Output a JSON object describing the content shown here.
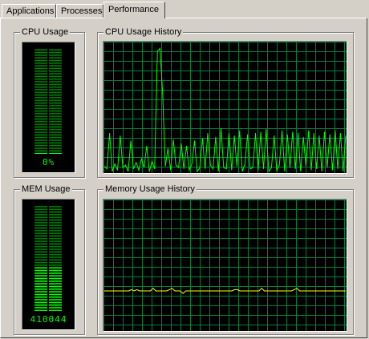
{
  "tabs": [
    {
      "label": "Applications",
      "active": false
    },
    {
      "label": "Processes",
      "active": false
    },
    {
      "label": "Performance",
      "active": true
    }
  ],
  "cpu_usage": {
    "title": "CPU Usage",
    "value_text": "0%",
    "percent": 0
  },
  "cpu_history": {
    "title": "CPU Usage History"
  },
  "mem_usage": {
    "title": "MEM Usage",
    "value_text": "410044",
    "fill_fraction": 0.42
  },
  "mem_history": {
    "title": "Memory Usage History"
  },
  "colors": {
    "grid": "#008040",
    "cpu_line": "#00ff00",
    "mem_line": "#ffff00",
    "meter_off": "#008000",
    "meter_on": "#00ff00"
  },
  "cpu_history_series": [
    4,
    2,
    30,
    0,
    6,
    1,
    28,
    3,
    5,
    0,
    24,
    2,
    7,
    1,
    10,
    3,
    20,
    0,
    8,
    2,
    94,
    96,
    60,
    4,
    18,
    1,
    25,
    5,
    3,
    22,
    2,
    20,
    1,
    6,
    24,
    0,
    3,
    26,
    2,
    30,
    5,
    2,
    27,
    0,
    34,
    3,
    2,
    30,
    1,
    28,
    4,
    32,
    0,
    6,
    29,
    2,
    3,
    30,
    1,
    31,
    2,
    33,
    0,
    3,
    28,
    1,
    5,
    32,
    0,
    29,
    3,
    31,
    2,
    30,
    0,
    27,
    4,
    32,
    1,
    30,
    2,
    28,
    0,
    31,
    3,
    29,
    1,
    32,
    2,
    30,
    0,
    28
  ],
  "mem_history_series": [
    30,
    30,
    30,
    30,
    30,
    30,
    30,
    30,
    30,
    30,
    31,
    30,
    31,
    30,
    30,
    30,
    30,
    30,
    32,
    30,
    30,
    30,
    30,
    30,
    31,
    32,
    30,
    30,
    30,
    28,
    30,
    30,
    30,
    30,
    30,
    30,
    30,
    30,
    30,
    30,
    30,
    30,
    30,
    30,
    30,
    30,
    30,
    30,
    31,
    31,
    30,
    30,
    30,
    30,
    30,
    30,
    30,
    30,
    32,
    30,
    30,
    30,
    30,
    30,
    30,
    30,
    30,
    30,
    30,
    30,
    31,
    32,
    30,
    30,
    30,
    30,
    30,
    30,
    30,
    30,
    30,
    30,
    30,
    30,
    30,
    30,
    30,
    30,
    30,
    30
  ]
}
